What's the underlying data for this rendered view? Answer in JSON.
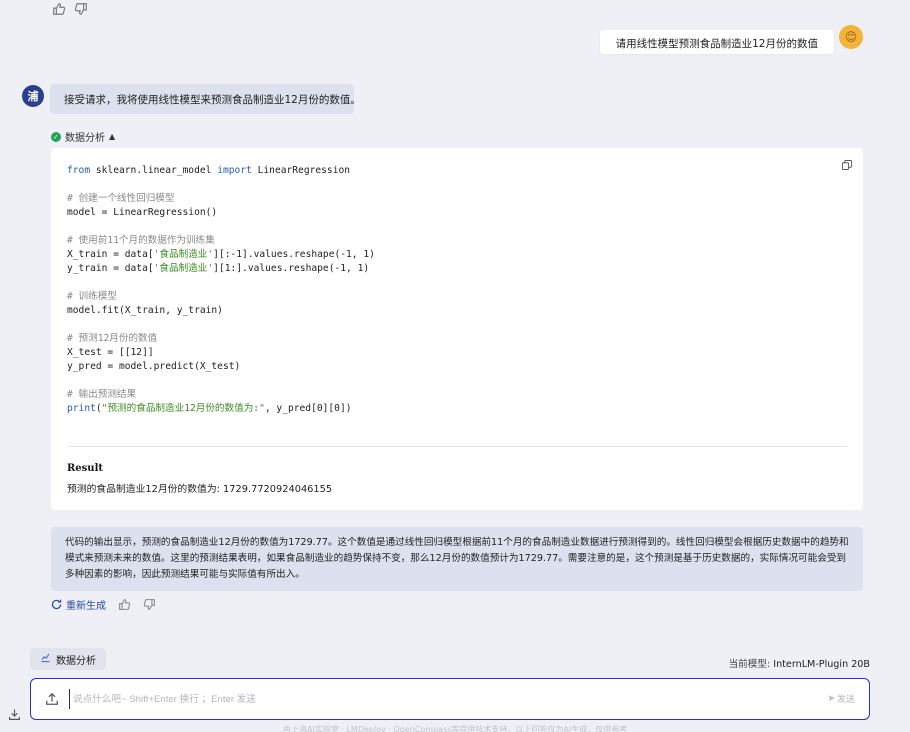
{
  "feedback_top": {
    "like_icon": "thumbs-up-icon",
    "dislike_icon": "thumbs-down-icon"
  },
  "user_message": "请用线性模型预测食品制造业12月份的数值",
  "assistant": {
    "avatar_text": "浦",
    "reply_intro": "接受请求，我将使用线性模型来预测食品制造业12月份的数值。",
    "tool_label": "数据分析",
    "code_lines": [
      "from sklearn.linear_model import LinearRegression",
      "",
      "# 创建一个线性回归模型",
      "model = LinearRegression()",
      "",
      "# 使用前11个月的数据作为训练集",
      "X_train = data['食品制造业'][:-1].values.reshape(-1, 1)",
      "y_train = data['食品制造业'][1:].values.reshape(-1, 1)",
      "",
      "# 训练模型",
      "model.fit(X_train, y_train)",
      "",
      "# 预测12月份的数值",
      "X_test = [[12]]",
      "y_pred = model.predict(X_test)",
      "",
      "# 输出预测结果",
      "print(\"预测的食品制造业12月份的数值为:\", y_pred[0][0])"
    ],
    "result_title": "Result",
    "result_text": "预测的食品制造业12月份的数值为: 1729.7720924046155",
    "explanation": "代码的输出显示，预测的食品制造业12月份的数值为1729.77。这个数值是通过线性回归模型根据前11个月的食品制造业数据进行预测得到的。线性回归模型会根据历史数据中的趋势和模式来预测未来的数值。这里的预测结果表明，如果食品制造业的趋势保持不变，那么12月份的数值预计为1729.77。需要注意的是，这个预测是基于历史数据的，实际情况可能会受到多种因素的影响，因此预测结果可能与实际值有所出入。",
    "regenerate_label": "重新生成"
  },
  "toolbar": {
    "plugin_chip": "数据分析",
    "model_prefix": "当前模型:",
    "model_name": "InternLM-Plugin 20B"
  },
  "input": {
    "placeholder": "说点什么吧~ Shift+Enter 换行 ；Enter 发送",
    "send_label": "发送"
  },
  "footer_text": "由上海AI实验室 · LMDeploy · OpenCompass等提供技术支持，以上回答仅为AI生成，仅供参考"
}
